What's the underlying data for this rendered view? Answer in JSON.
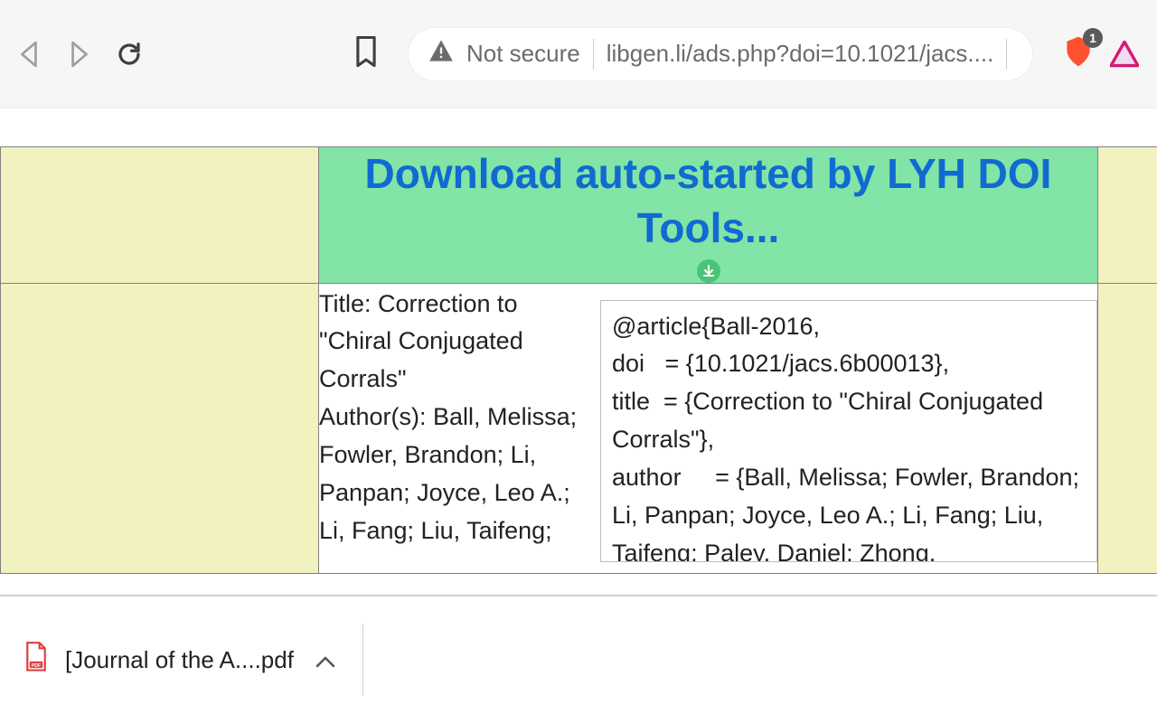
{
  "toolbar": {
    "not_secure_label": "Not secure",
    "url_display": "libgen.li/ads.php?doi=10.1021/jacs....",
    "shield_badge": "1"
  },
  "banner": {
    "headline": "Download auto-started by LYH DOI Tools..."
  },
  "metadata": {
    "text": "Title: Correction to \"Chiral Conjugated Corrals\"\nAuthor(s): Ball, Melissa; Fowler, Brandon; Li, Panpan; Joyce, Leo A.; Li, Fang; Liu, Taifeng;"
  },
  "bibtex": {
    "text": "@article{Ball-2016,\ndoi   = {10.1021/jacs.6b00013},\ntitle  = {Correction to \"Chiral Conjugated Corrals\"},\nauthor     = {Ball, Melissa; Fowler, Brandon; Li, Panpan; Joyce, Leo A.; Li, Fang; Liu, Taifeng; Paley, Daniel; Zhong,"
  },
  "downloads": {
    "filename": "[Journal of the A....pdf"
  }
}
